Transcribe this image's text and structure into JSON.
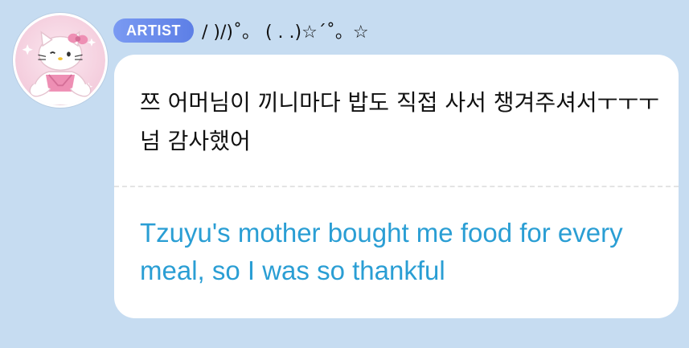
{
  "post": {
    "author_badge": "ARTIST",
    "author_name": "/ )/)˚。 ( . .)☆´˚。☆",
    "original_text": " 쯔 어머님이 끼니마다 밥도 직접 사서 챙겨주셔서ㅜㅜㅜ 넘 감사했어",
    "translation_text": "Tzuyu's mother bought me food for every meal, so I was so thankful"
  },
  "icons": {
    "avatar": "hello-kitty-avatar-icon"
  },
  "colors": {
    "background": "#c6dcf1",
    "bubble": "#ffffff",
    "badge": "#6f8ff0",
    "translation": "#2a9ed4"
  }
}
